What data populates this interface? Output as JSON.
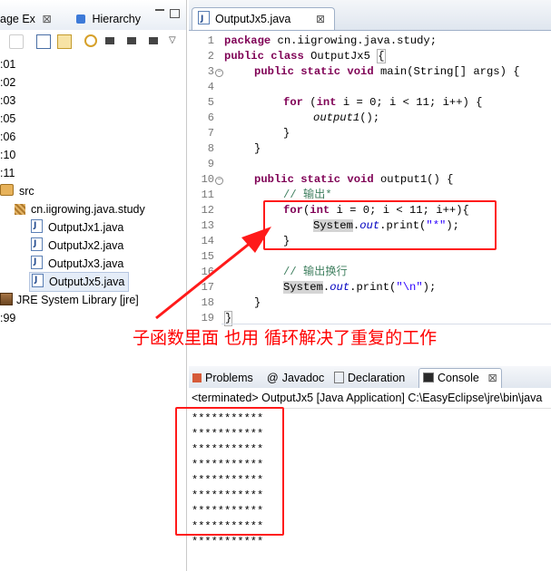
{
  "left_panel": {
    "tab_package_explorer": "age Ex",
    "tab_hierarchy": "Hierarchy",
    "rows": [
      ":01",
      ":02",
      ":03",
      ":05",
      ":06",
      ":10",
      ":11"
    ],
    "project_src": "src",
    "package_name": "cn.iigrowing.java.study",
    "files": [
      "OutputJx1.java",
      "OutputJx2.java",
      "OutputJx3.java",
      "OutputJx5.java"
    ],
    "library": "JRE System Library [jre]",
    "trailing_row": ":99"
  },
  "editor": {
    "tab_title": "OutputJx5.java",
    "lines": [
      {
        "n": "1"
      },
      {
        "n": "2"
      },
      {
        "n": "3"
      },
      {
        "n": "4"
      },
      {
        "n": "5"
      },
      {
        "n": "6"
      },
      {
        "n": "7"
      },
      {
        "n": "8"
      },
      {
        "n": "9"
      },
      {
        "n": "10"
      },
      {
        "n": "11"
      },
      {
        "n": "12"
      },
      {
        "n": "13"
      },
      {
        "n": "14"
      },
      {
        "n": "15"
      },
      {
        "n": "16"
      },
      {
        "n": "17"
      },
      {
        "n": "18"
      },
      {
        "n": "19"
      }
    ],
    "code": {
      "l1_kw": "package",
      "l1_rest": " cn.iigrowing.java.study;",
      "l2_kw1": "public",
      "l2_kw2": "class",
      "l2_rest": " OutputJx5 ",
      "l2_brace": "{",
      "l3_kw": "public static void",
      "l3_rest": " main(String[] args) {",
      "l5_kw": "for",
      "l5_p1": " (",
      "l5_kw2": "int",
      "l5_rest": " i = 0; i < 11; i++) {",
      "l6_call": "output1",
      "l6_rest": "();",
      "l7": "}",
      "l8": "}",
      "l10_kw": "public static void",
      "l10_rest": " output1() {",
      "l11_cm": "// 输出*",
      "l12_kw": "for",
      "l12_p1": "(",
      "l12_kw2": "int",
      "l12_rest": " i = 0; i < 11; i++){",
      "l13_sys": "System",
      "l13_dot": ".",
      "l13_out": "out",
      "l13_print": ".print(",
      "l13_str": "\"*\"",
      "l13_end": ");",
      "l14": "}",
      "l16_cm": "// 输出换行",
      "l17_sys": "System",
      "l17_dot": ".",
      "l17_out": "out",
      "l17_print": ".print(",
      "l17_str": "\"\\n\"",
      "l17_end": ");",
      "l18": "}",
      "l19": "}"
    }
  },
  "console": {
    "tabs": [
      "Problems",
      "Javadoc",
      "Declaration",
      "Console"
    ],
    "header": "<terminated> OutputJx5 [Java Application] C:\\EasyEclipse\\jre\\bin\\java",
    "output_lines": [
      "***********",
      "***********",
      "***********",
      "***********",
      "***********",
      "***********",
      "***********",
      "***********",
      "***********"
    ]
  },
  "annotation": {
    "text": "子函数里面 也用  循环解决了重复的工作",
    "color": "#ff0000"
  },
  "colors": {
    "keyword": "#7f0055",
    "comment": "#3f7f5f",
    "string": "#2a00ff",
    "field": "#0000c0",
    "highlight_box": "#ff1a1a"
  }
}
